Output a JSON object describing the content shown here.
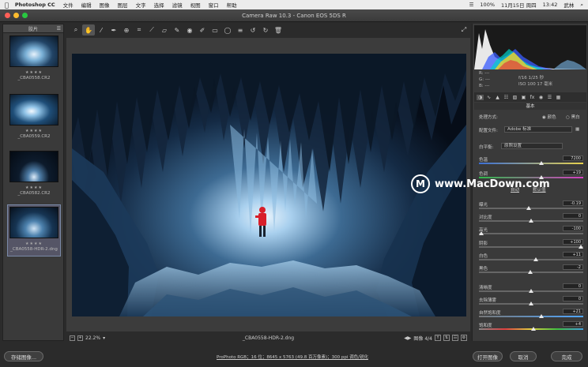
{
  "menubar": {
    "apple": "",
    "app": "Photoshop CC",
    "items": [
      "文件",
      "编辑",
      "图像",
      "图层",
      "文字",
      "选择",
      "滤镜",
      "视图",
      "窗口",
      "帮助"
    ],
    "status": {
      "battery": "100%",
      "date": "11月15日 周四",
      "time": "13:42",
      "user": "武林"
    }
  },
  "window": {
    "title": "Camera Raw 10.3 -  Canon EOS 5DS R"
  },
  "filmstrip": {
    "header": "胶片",
    "items": [
      {
        "name": "_CBA0558.CR2",
        "stars": "★★★★"
      },
      {
        "name": "_CBA0559.CR2",
        "stars": "★★★★"
      },
      {
        "name": "_CBA0582.CR2",
        "stars": "★★★★"
      },
      {
        "name": "_CBA0558-HDR-2.dng",
        "stars": "★★★★"
      }
    ]
  },
  "toolbar": {
    "icons": [
      "zoom-icon",
      "hand-icon",
      "white-balance-icon",
      "color-sampler-icon",
      "target-adjust-icon",
      "crop-icon",
      "straighten-icon",
      "transform-icon",
      "spot-removal-icon",
      "red-eye-icon",
      "adjustment-brush-icon",
      "graduated-filter-icon",
      "radial-filter-icon",
      "preferences-icon",
      "rotate-ccw-icon",
      "rotate-cw-icon",
      "trash-icon"
    ],
    "glyphs": [
      "⌕",
      "✋",
      "⁄",
      "✒",
      "⊕",
      "⌗",
      "⟋",
      "▱",
      "✎",
      "◉",
      "✐",
      "▭",
      "◯",
      "≡",
      "↺",
      "↻",
      "🗑"
    ]
  },
  "status": {
    "zoom": "22.2%",
    "filename": "_CBA0558-HDR-2.dng",
    "counter": "图像 4/4"
  },
  "readout": {
    "r": "R:  ---",
    "g": "G:  ---",
    "b": "B:  ---",
    "exif1": "f/16     1/25 秒",
    "exif2": "ISO 100   17 毫米"
  },
  "panel": {
    "title": "基本",
    "process_label": "处理方式:",
    "process_color": "颜色",
    "process_bw": "黑白",
    "profile_label": "配置文件:",
    "profile_value": "Adobe 标准",
    "wb_label": "白平衡:",
    "wb_value": "原照设置",
    "auto": "自动",
    "default": "默认值",
    "sliders": [
      {
        "label": "色温",
        "value": "7200",
        "pos": 0.6
      },
      {
        "label": "色调",
        "value": "+19",
        "pos": 0.6
      },
      {
        "label": "曝光",
        "value": "-0.19",
        "pos": 0.48
      },
      {
        "label": "对比度",
        "value": "0",
        "pos": 0.5
      },
      {
        "label": "高光",
        "value": "-100",
        "pos": 0.0
      },
      {
        "label": "阴影",
        "value": "+100",
        "pos": 1.0
      },
      {
        "label": "白色",
        "value": "+11",
        "pos": 0.55
      },
      {
        "label": "黑色",
        "value": "-2",
        "pos": 0.49
      },
      {
        "label": "清晰度",
        "value": "0",
        "pos": 0.5
      },
      {
        "label": "去除薄雾",
        "value": "0",
        "pos": 0.5
      },
      {
        "label": "自然饱和度",
        "value": "+21",
        "pos": 0.6
      },
      {
        "label": "饱和度",
        "value": "+4",
        "pos": 0.52
      }
    ]
  },
  "footer": {
    "save": "存储图像...",
    "info": "ProPhoto RGB；16 位；8645 x 5763 (49.8 百万像素)；300 ppi 调色/锐化",
    "open": "打开图像",
    "cancel": "取消",
    "done": "完成"
  },
  "watermark": "www.MacDown.com",
  "colors": {
    "accent": "#7a8aa8",
    "ice": "#3d6a92",
    "jacket": "#d81f2a"
  }
}
